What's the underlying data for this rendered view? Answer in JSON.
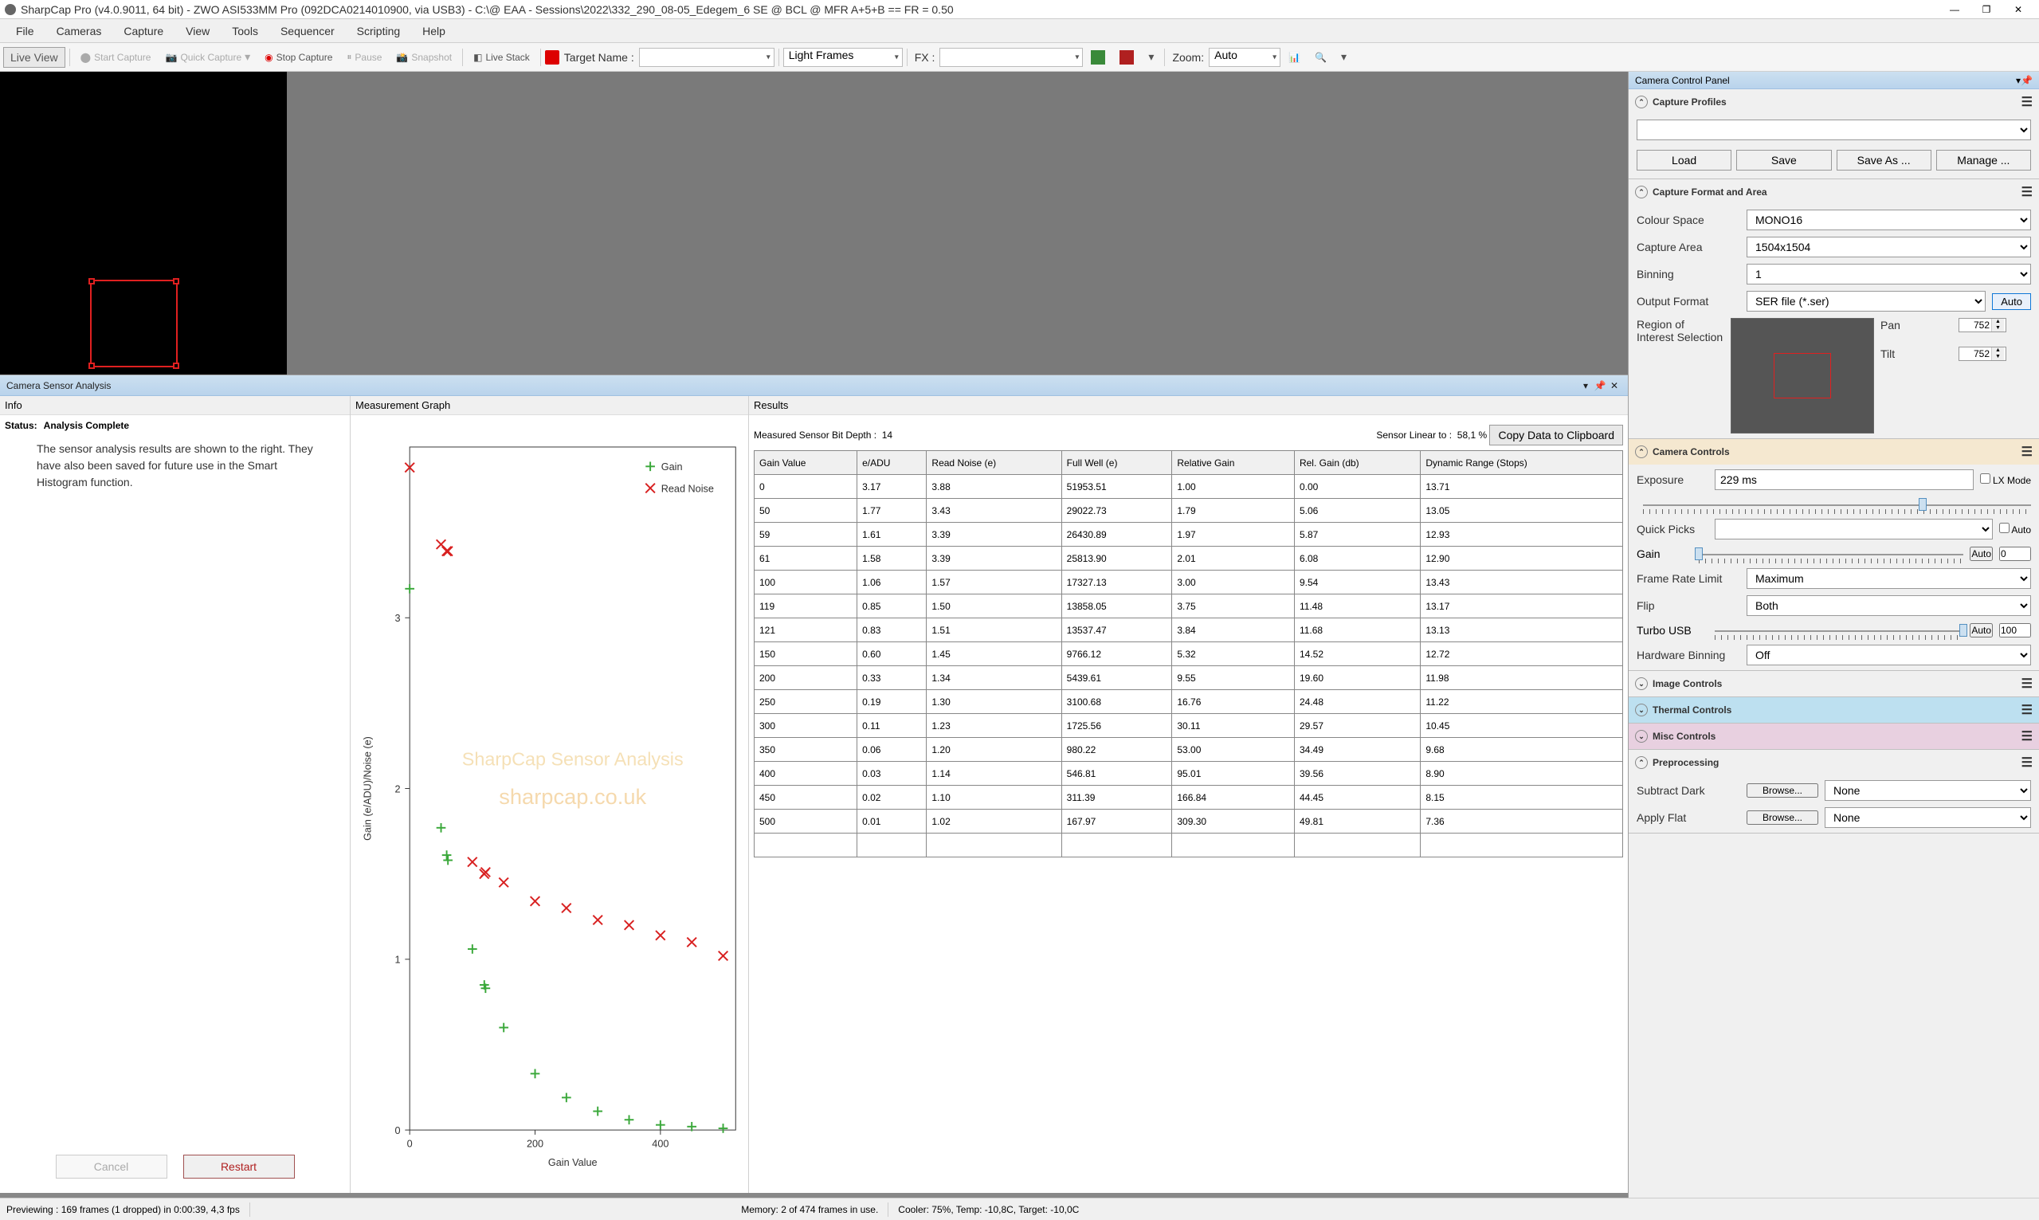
{
  "window": {
    "title": "SharpCap Pro (v4.0.9011, 64 bit) - ZWO ASI533MM Pro (092DCA0214010900, via USB3) - C:\\@ EAA - Sessions\\2022\\332_290_08-05_Edegem_6 SE @ BCL @ MFR A+5+B == FR = 0.50"
  },
  "menu": {
    "file": "File",
    "cameras": "Cameras",
    "capture": "Capture",
    "view": "View",
    "tools": "Tools",
    "sequencer": "Sequencer",
    "scripting": "Scripting",
    "help": "Help"
  },
  "toolbar": {
    "live_view": "Live View",
    "start_capture": "Start Capture",
    "quick_capture": "Quick Capture",
    "stop_capture": "Stop Capture",
    "pause": "Pause",
    "snapshot": "Snapshot",
    "live_stack": "Live Stack",
    "target_name_lbl": "Target Name :",
    "target_name_val": "",
    "frame_type": "Light Frames",
    "fx_lbl": "FX :",
    "fx_val": "",
    "zoom_lbl": "Zoom:",
    "zoom_val": "Auto"
  },
  "csa": {
    "panel_title": "Camera Sensor Analysis",
    "info_title": "Info",
    "status_lbl": "Status:",
    "status_val": "Analysis Complete",
    "desc": "The sensor analysis results are shown to the right. They have also been saved for future use in the Smart Histogram function.",
    "cancel": "Cancel",
    "restart": "Restart",
    "graph_title": "Measurement Graph",
    "graph_legend_gain": "Gain",
    "graph_legend_noise": "Read Noise",
    "graph_y_label": "Gain (e/ADU)/Noise (e)",
    "graph_x_label": "Gain Value",
    "wm1": "SharpCap Sensor Analysis",
    "wm2": "sharpcap.co.uk",
    "results_title": "Results",
    "bitdepth_lbl": "Measured Sensor Bit Depth :",
    "bitdepth_val": "14",
    "linear_lbl": "Sensor Linear to :",
    "linear_val": "58,1 %",
    "copy_btn": "Copy Data to Clipboard",
    "headers": [
      "Gain Value",
      "e/ADU",
      "Read Noise (e)",
      "Full Well (e)",
      "Relative Gain",
      "Rel. Gain (db)",
      "Dynamic Range (Stops)"
    ],
    "rows": [
      [
        "0",
        "3.17",
        "3.88",
        "51953.51",
        "1.00",
        "0.00",
        "13.71"
      ],
      [
        "50",
        "1.77",
        "3.43",
        "29022.73",
        "1.79",
        "5.06",
        "13.05"
      ],
      [
        "59",
        "1.61",
        "3.39",
        "26430.89",
        "1.97",
        "5.87",
        "12.93"
      ],
      [
        "61",
        "1.58",
        "3.39",
        "25813.90",
        "2.01",
        "6.08",
        "12.90"
      ],
      [
        "100",
        "1.06",
        "1.57",
        "17327.13",
        "3.00",
        "9.54",
        "13.43"
      ],
      [
        "119",
        "0.85",
        "1.50",
        "13858.05",
        "3.75",
        "11.48",
        "13.17"
      ],
      [
        "121",
        "0.83",
        "1.51",
        "13537.47",
        "3.84",
        "11.68",
        "13.13"
      ],
      [
        "150",
        "0.60",
        "1.45",
        "9766.12",
        "5.32",
        "14.52",
        "12.72"
      ],
      [
        "200",
        "0.33",
        "1.34",
        "5439.61",
        "9.55",
        "19.60",
        "11.98"
      ],
      [
        "250",
        "0.19",
        "1.30",
        "3100.68",
        "16.76",
        "24.48",
        "11.22"
      ],
      [
        "300",
        "0.11",
        "1.23",
        "1725.56",
        "30.11",
        "29.57",
        "10.45"
      ],
      [
        "350",
        "0.06",
        "1.20",
        "980.22",
        "53.00",
        "34.49",
        "9.68"
      ],
      [
        "400",
        "0.03",
        "1.14",
        "546.81",
        "95.01",
        "39.56",
        "8.90"
      ],
      [
        "450",
        "0.02",
        "1.10",
        "311.39",
        "166.84",
        "44.45",
        "8.15"
      ],
      [
        "500",
        "0.01",
        "1.02",
        "167.97",
        "309.30",
        "49.81",
        "7.36"
      ]
    ]
  },
  "chart_data": {
    "type": "scatter",
    "xlabel": "Gain Value",
    "ylabel": "Gain (e/ADU)/Noise (e)",
    "x_ticks": [
      0,
      200,
      400
    ],
    "y_ticks": [
      0,
      1,
      2,
      3
    ],
    "xlim": [
      0,
      520
    ],
    "ylim": [
      0,
      4
    ],
    "series": [
      {
        "name": "Gain",
        "marker": "plus",
        "color": "#3aa83a",
        "x": [
          0,
          50,
          59,
          61,
          100,
          119,
          121,
          150,
          200,
          250,
          300,
          350,
          400,
          450,
          500
        ],
        "y": [
          3.17,
          1.77,
          1.61,
          1.58,
          1.06,
          0.85,
          0.83,
          0.6,
          0.33,
          0.19,
          0.11,
          0.06,
          0.03,
          0.02,
          0.01
        ]
      },
      {
        "name": "Read Noise",
        "marker": "cross",
        "color": "#d82020",
        "x": [
          0,
          50,
          59,
          61,
          100,
          119,
          121,
          150,
          200,
          250,
          300,
          350,
          400,
          450,
          500
        ],
        "y": [
          3.88,
          3.43,
          3.39,
          3.39,
          1.57,
          1.5,
          1.51,
          1.45,
          1.34,
          1.3,
          1.23,
          1.2,
          1.14,
          1.1,
          1.02
        ]
      }
    ],
    "watermark": [
      "SharpCap Sensor Analysis",
      "sharpcap.co.uk"
    ]
  },
  "ccp": {
    "title": "Camera Control Panel",
    "profiles_hdr": "Capture Profiles",
    "load": "Load",
    "save": "Save",
    "saveas": "Save As ...",
    "manage": "Manage ...",
    "format_hdr": "Capture Format and Area",
    "colour_space_lbl": "Colour Space",
    "colour_space_val": "MONO16",
    "capture_area_lbl": "Capture Area",
    "capture_area_val": "1504x1504",
    "binning_lbl": "Binning",
    "binning_val": "1",
    "output_fmt_lbl": "Output Format",
    "output_fmt_val": "SER file (*.ser)",
    "auto": "Auto",
    "roi_lbl": "Region of Interest Selection",
    "pan_lbl": "Pan",
    "pan_val": "752",
    "tilt_lbl": "Tilt",
    "tilt_val": "752",
    "camera_ctrls_hdr": "Camera Controls",
    "exposure_lbl": "Exposure",
    "exposure_val": "229 ms",
    "lx_mode": "LX Mode",
    "quick_picks_lbl": "Quick Picks",
    "gain_lbl": "Gain",
    "gain_val": "0",
    "framerate_lbl": "Frame Rate Limit",
    "framerate_val": "Maximum",
    "flip_lbl": "Flip",
    "flip_val": "Both",
    "turbo_lbl": "Turbo USB",
    "turbo_val": "100",
    "hw_binning_lbl": "Hardware Binning",
    "hw_binning_val": "Off",
    "image_controls_hdr": "Image Controls",
    "thermal_hdr": "Thermal Controls",
    "misc_hdr": "Misc Controls",
    "preproc_hdr": "Preprocessing",
    "subtract_dark_lbl": "Subtract Dark",
    "browse": "Browse...",
    "none": "None",
    "apply_flat_lbl": "Apply Flat"
  },
  "statusbar": {
    "preview": "Previewing : 169 frames (1 dropped) in 0:00:39, 4,3 fps",
    "memory": "Memory: 2 of 474 frames in use.",
    "cooler": "Cooler: 75%, Temp: -10,8C, Target: -10,0C"
  }
}
